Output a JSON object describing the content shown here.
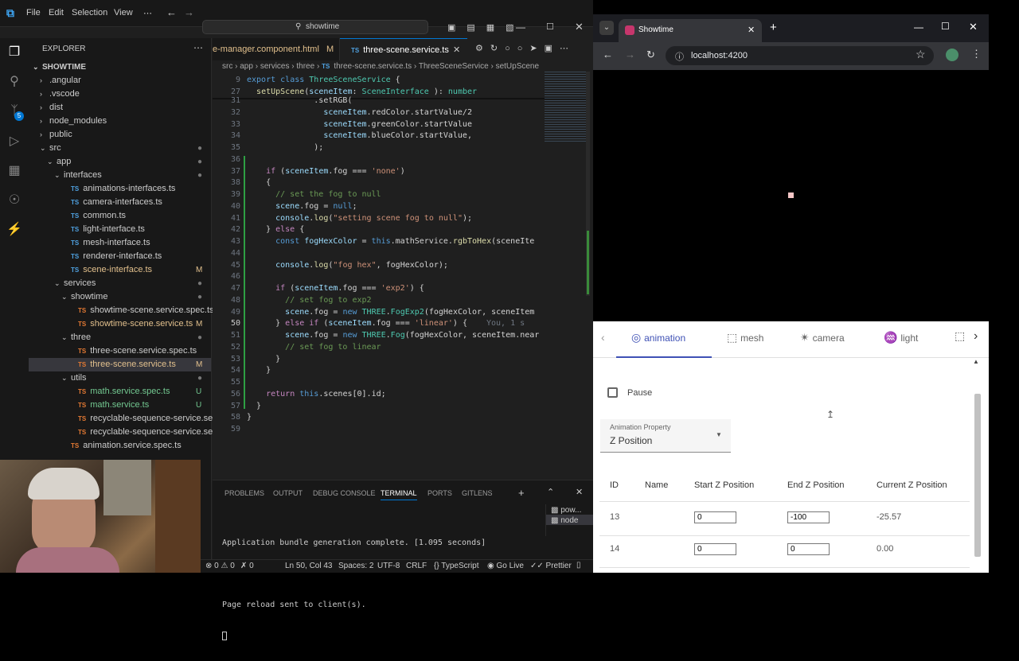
{
  "vscode": {
    "menu": [
      "File",
      "Edit",
      "Selection",
      "View",
      "⋯"
    ],
    "search_text": "showtime",
    "explorer_title": "EXPLORER",
    "root_folder": "SHOWTIME",
    "tree": [
      {
        "label": ".angular",
        "indent": 1,
        "folder": true,
        "open": false
      },
      {
        "label": ".vscode",
        "indent": 1,
        "folder": true,
        "open": false
      },
      {
        "label": "dist",
        "indent": 1,
        "folder": true,
        "open": false
      },
      {
        "label": "node_modules",
        "indent": 1,
        "folder": true,
        "open": false
      },
      {
        "label": "public",
        "indent": 1,
        "folder": true,
        "open": false
      },
      {
        "label": "src",
        "indent": 1,
        "folder": true,
        "open": true
      },
      {
        "label": "app",
        "indent": 2,
        "folder": true,
        "open": true
      },
      {
        "label": "interfaces",
        "indent": 3,
        "folder": true,
        "open": true
      },
      {
        "label": "animations-interfaces.ts",
        "indent": 4,
        "ts": "TS"
      },
      {
        "label": "camera-interfaces.ts",
        "indent": 4,
        "ts": "TS"
      },
      {
        "label": "common.ts",
        "indent": 4,
        "ts": "TS"
      },
      {
        "label": "light-interface.ts",
        "indent": 4,
        "ts": "TS"
      },
      {
        "label": "mesh-interface.ts",
        "indent": 4,
        "ts": "TS"
      },
      {
        "label": "renderer-interface.ts",
        "indent": 4,
        "ts": "TS"
      },
      {
        "label": "scene-interface.ts",
        "indent": 4,
        "ts": "TS",
        "badge": "M"
      },
      {
        "label": "services",
        "indent": 3,
        "folder": true,
        "open": true
      },
      {
        "label": "showtime",
        "indent": 4,
        "folder": true,
        "open": true
      },
      {
        "label": "showtime-scene.service.spec.ts",
        "indent": 5,
        "ts": "TS",
        "red": true
      },
      {
        "label": "showtime-scene.service.ts",
        "indent": 5,
        "ts": "TS",
        "red": true,
        "badge": "M"
      },
      {
        "label": "three",
        "indent": 4,
        "folder": true,
        "open": true
      },
      {
        "label": "three-scene.service.spec.ts",
        "indent": 5,
        "ts": "TS",
        "red": true
      },
      {
        "label": "three-scene.service.ts",
        "indent": 5,
        "ts": "TS",
        "red": true,
        "badge": "M",
        "selected": true
      },
      {
        "label": "utils",
        "indent": 4,
        "folder": true,
        "open": true
      },
      {
        "label": "math.service.spec.ts",
        "indent": 5,
        "ts": "TS",
        "red": true,
        "badge": "U"
      },
      {
        "label": "math.service.ts",
        "indent": 5,
        "ts": "TS",
        "red": true,
        "badge": "U"
      },
      {
        "label": "recyclable-sequence-service.service.sp...",
        "indent": 5,
        "ts": "TS",
        "red": true
      },
      {
        "label": "recyclable-sequence-service.service.ts",
        "indent": 5,
        "ts": "TS",
        "red": true
      },
      {
        "label": "animation.service.spec.ts",
        "indent": 4,
        "ts": "TS",
        "red": true
      }
    ],
    "tabs": {
      "left": "e-manager.component.html",
      "left_badge": "M",
      "active": "three-scene.service.ts"
    },
    "breadcrumb": [
      "src",
      "app",
      "services",
      "three",
      "three-scene.service.ts",
      "ThreeSceneService",
      "setUpScene"
    ],
    "sticky": [
      {
        "ln": "9",
        "parts": [
          [
            "kw2",
            "export "
          ],
          [
            "kw2",
            "class "
          ],
          [
            "cls",
            "ThreeSceneService "
          ],
          [
            "",
            "{"
          ]
        ]
      },
      {
        "ln": "27",
        "parts": [
          [
            "",
            "  "
          ],
          [
            "fn",
            "setUpScene"
          ],
          [
            "",
            "("
          ],
          [
            "var",
            "sceneItem"
          ],
          [
            "",
            ": "
          ],
          [
            "cls",
            "SceneInterface "
          ],
          [
            "",
            "): "
          ],
          [
            "cls",
            "number"
          ]
        ]
      }
    ],
    "lines": [
      {
        "ln": "31",
        "parts": [
          [
            "",
            "              .setRGB("
          ]
        ]
      },
      {
        "ln": "32",
        "parts": [
          [
            "",
            "                "
          ],
          [
            "var",
            "sceneItem"
          ],
          [
            "",
            ".redColor.startValue/2"
          ]
        ]
      },
      {
        "ln": "33",
        "parts": [
          [
            "",
            "                "
          ],
          [
            "var",
            "sceneItem"
          ],
          [
            "",
            ".greenColor.startValue"
          ]
        ]
      },
      {
        "ln": "34",
        "parts": [
          [
            "",
            "                "
          ],
          [
            "var",
            "sceneItem"
          ],
          [
            "",
            ".blueColor.startValue,"
          ]
        ]
      },
      {
        "ln": "35",
        "parts": [
          [
            "",
            "              );"
          ]
        ]
      },
      {
        "ln": "36",
        "parts": []
      },
      {
        "ln": "37",
        "parts": [
          [
            "",
            "    "
          ],
          [
            "kw",
            "if "
          ],
          [
            "",
            "("
          ],
          [
            "var",
            "sceneItem"
          ],
          [
            "",
            ".fog === "
          ],
          [
            "str",
            "'none'"
          ],
          [
            "",
            ")"
          ]
        ]
      },
      {
        "ln": "38",
        "parts": [
          [
            "",
            "    {"
          ]
        ]
      },
      {
        "ln": "39",
        "parts": [
          [
            "",
            "      "
          ],
          [
            "com",
            "// set the fog to null"
          ]
        ]
      },
      {
        "ln": "40",
        "parts": [
          [
            "",
            "      "
          ],
          [
            "var",
            "scene"
          ],
          [
            "",
            ".fog = "
          ],
          [
            "kw2",
            "null"
          ],
          [
            "",
            ";"
          ]
        ]
      },
      {
        "ln": "41",
        "parts": [
          [
            "",
            "      "
          ],
          [
            "var",
            "console"
          ],
          [
            "",
            "."
          ],
          [
            "fn",
            "log"
          ],
          [
            "",
            "("
          ],
          [
            "str",
            "\"setting scene fog to null\""
          ],
          [
            "",
            ");"
          ]
        ]
      },
      {
        "ln": "42",
        "parts": [
          [
            "",
            "    } "
          ],
          [
            "kw",
            "else "
          ],
          [
            "",
            "{"
          ]
        ]
      },
      {
        "ln": "43",
        "parts": [
          [
            "",
            "      "
          ],
          [
            "kw2",
            "const "
          ],
          [
            "var",
            "fogHexColor"
          ],
          [
            "",
            " = "
          ],
          [
            "kw2",
            "this"
          ],
          [
            "",
            ".mathService."
          ],
          [
            "fn",
            "rgbToHex"
          ],
          [
            "",
            "(sceneIte"
          ]
        ]
      },
      {
        "ln": "44",
        "parts": []
      },
      {
        "ln": "45",
        "parts": [
          [
            "",
            "      "
          ],
          [
            "var",
            "console"
          ],
          [
            "",
            "."
          ],
          [
            "fn",
            "log"
          ],
          [
            "",
            "("
          ],
          [
            "str",
            "\"fog hex\""
          ],
          [
            "",
            ", fogHexColor);"
          ]
        ]
      },
      {
        "ln": "46",
        "parts": []
      },
      {
        "ln": "47",
        "parts": [
          [
            "",
            "      "
          ],
          [
            "kw",
            "if "
          ],
          [
            "",
            "("
          ],
          [
            "var",
            "sceneItem"
          ],
          [
            "",
            ".fog === "
          ],
          [
            "str",
            "'exp2'"
          ],
          [
            "",
            ") {"
          ]
        ]
      },
      {
        "ln": "48",
        "parts": [
          [
            "",
            "        "
          ],
          [
            "com",
            "// set fog to exp2"
          ]
        ]
      },
      {
        "ln": "49",
        "parts": [
          [
            "",
            "        "
          ],
          [
            "var",
            "scene"
          ],
          [
            "",
            ".fog = "
          ],
          [
            "kw2",
            "new "
          ],
          [
            "cls",
            "THREE"
          ],
          [
            "",
            "."
          ],
          [
            "cls",
            "FogExp2"
          ],
          [
            "",
            "(fogHexColor, sceneItem"
          ]
        ]
      },
      {
        "ln": "50",
        "parts": [
          [
            "",
            "      } "
          ],
          [
            "kw",
            "else if "
          ],
          [
            "",
            "("
          ],
          [
            "var",
            "sceneItem"
          ],
          [
            "",
            ".fog === "
          ],
          [
            "str",
            "'linear'"
          ],
          [
            "",
            ") {"
          ]
        ]
      },
      {
        "ln": "51",
        "parts": [
          [
            "",
            "        "
          ],
          [
            "var",
            "scene"
          ],
          [
            "",
            ".fog = "
          ],
          [
            "kw2",
            "new "
          ],
          [
            "cls",
            "THREE"
          ],
          [
            "",
            "."
          ],
          [
            "cls",
            "Fog"
          ],
          [
            "",
            "(fogHexColor, sceneItem.near"
          ]
        ]
      },
      {
        "ln": "52",
        "parts": [
          [
            "",
            "        "
          ],
          [
            "com",
            "// set fog to linear"
          ]
        ]
      },
      {
        "ln": "53",
        "parts": [
          [
            "",
            "      }"
          ]
        ]
      },
      {
        "ln": "54",
        "parts": [
          [
            "",
            "    }"
          ]
        ]
      },
      {
        "ln": "55",
        "parts": []
      },
      {
        "ln": "56",
        "parts": [
          [
            "",
            "    "
          ],
          [
            "kw",
            "return "
          ],
          [
            "kw2",
            "this"
          ],
          [
            "",
            ".scenes[0].id;"
          ]
        ]
      },
      {
        "ln": "57",
        "parts": [
          [
            "",
            "  }"
          ]
        ]
      },
      {
        "ln": "58",
        "parts": [
          [
            "",
            "}"
          ]
        ]
      },
      {
        "ln": "59",
        "parts": []
      }
    ],
    "ghost_text": "You, 1 s",
    "panel_tabs": [
      "PROBLEMS",
      "OUTPUT",
      "DEBUG CONSOLE",
      "TERMINAL",
      "PORTS",
      "GITLENS"
    ],
    "active_panel": "TERMINAL",
    "terminal_lines": [
      "Application bundle generation complete. [1.095 seconds]",
      "",
      "Page reload sent to client(s)."
    ],
    "terminal_sessions": [
      "pow...",
      "node"
    ],
    "status": {
      "errors": "0",
      "warnings": "0",
      "ports": "0",
      "position": "Ln 50, Col 43",
      "spaces": "Spaces: 2",
      "encoding": "UTF-8",
      "eol": "CRLF",
      "lang": "TypeScript",
      "golive": "Go Live",
      "prettier": "Prettier"
    }
  },
  "browser": {
    "tab_title": "Showtime",
    "url": "localhost:4200",
    "tabs": [
      {
        "label": "animation",
        "icon": "animation-icon",
        "active": true
      },
      {
        "label": "mesh",
        "icon": "mesh-icon"
      },
      {
        "label": "camera",
        "icon": "camera-icon"
      },
      {
        "label": "light",
        "icon": "light-icon"
      }
    ],
    "pause_label": "Pause",
    "select_label": "Animation Property",
    "select_value": "Z Position",
    "table_headers": [
      "ID",
      "Name",
      "Start Z Position",
      "End Z Position",
      "Current Z Position"
    ],
    "rows": [
      {
        "id": "13",
        "name": "",
        "start": "0",
        "end": "-100",
        "current": "-25.57"
      },
      {
        "id": "14",
        "name": "",
        "start": "0",
        "end": "0",
        "current": "0.00"
      }
    ]
  }
}
